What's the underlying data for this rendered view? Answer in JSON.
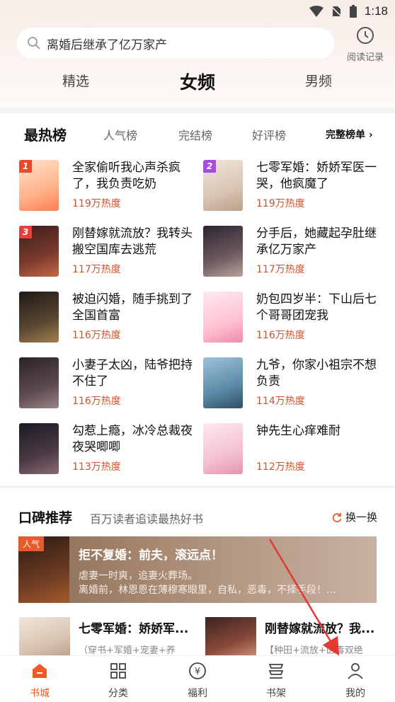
{
  "status_bar": {
    "time": "1:18"
  },
  "search": {
    "query": "离婚后继承了亿万家产",
    "history_label": "阅读记录"
  },
  "top_tabs": [
    {
      "label": "精选",
      "active": false
    },
    {
      "label": "女频",
      "active": true
    },
    {
      "label": "男频",
      "active": false
    }
  ],
  "ranking": {
    "tabs": [
      {
        "label": "最热榜",
        "active": true
      },
      {
        "label": "人气榜",
        "active": false
      },
      {
        "label": "完结榜",
        "active": false
      },
      {
        "label": "好评榜",
        "active": false
      }
    ],
    "full_list_label": "完整榜单 ›",
    "books": [
      {
        "rank": "1",
        "title": "全家偷听我心声杀疯了，我负责吃奶",
        "heat": "119万热度"
      },
      {
        "rank": "2",
        "title": "七零军婚：娇娇军医一哭，他疯魔了",
        "heat": "119万热度"
      },
      {
        "rank": "3",
        "title": "刚替嫁就流放？我转头搬空国库去逃荒",
        "heat": "117万热度"
      },
      {
        "rank": "",
        "title": "分手后，她藏起孕肚继承亿万家产",
        "heat": "117万热度"
      },
      {
        "rank": "",
        "title": "被迫闪婚，随手挑到了全国首富",
        "heat": "116万热度"
      },
      {
        "rank": "",
        "title": "奶包四岁半：下山后七个哥哥团宠我",
        "heat": "116万热度"
      },
      {
        "rank": "",
        "title": "小妻子太凶，陆爷把持不住了",
        "heat": "116万热度"
      },
      {
        "rank": "",
        "title": "九爷，你家小祖宗不想负责",
        "heat": "114万热度"
      },
      {
        "rank": "",
        "title": "勾惹上瘾，冰冷总裁夜夜哭唧唧",
        "heat": "113万热度"
      },
      {
        "rank": "",
        "title": "钟先生心痒难耐",
        "heat": "112万热度"
      }
    ]
  },
  "recommend": {
    "title": "口碑推荐",
    "subtitle": "百万读者追读最热好书",
    "refresh_label": "换一换",
    "featured": {
      "tag": "人气",
      "title": "拒不复婚：前夫，滚远点！",
      "desc_line1": "虐妻一时爽，追妻火葬场。",
      "desc_line2": "离婚前，林恩恩在薄穆寒眼里，自私，恶毒，不择手段！..."
    },
    "books": [
      {
        "title": "七零军婚：娇娇军...",
        "tags": "（穿书+军婚+宠妻+养"
      },
      {
        "title": "刚替嫁就流放？我...",
        "tags": "【种田+流放+医毒双绝"
      }
    ]
  },
  "bottom_nav": [
    {
      "label": "书城",
      "icon": "home-icon",
      "active": true
    },
    {
      "label": "分类",
      "icon": "grid-icon",
      "active": false
    },
    {
      "label": "福利",
      "icon": "yen-icon",
      "active": false
    },
    {
      "label": "书架",
      "icon": "bookshelf-icon",
      "active": false
    },
    {
      "label": "我的",
      "icon": "profile-icon",
      "active": false
    }
  ],
  "colors": {
    "accent": "#ef5a26",
    "heat": "#d2522a",
    "arrow": "#e53935"
  }
}
